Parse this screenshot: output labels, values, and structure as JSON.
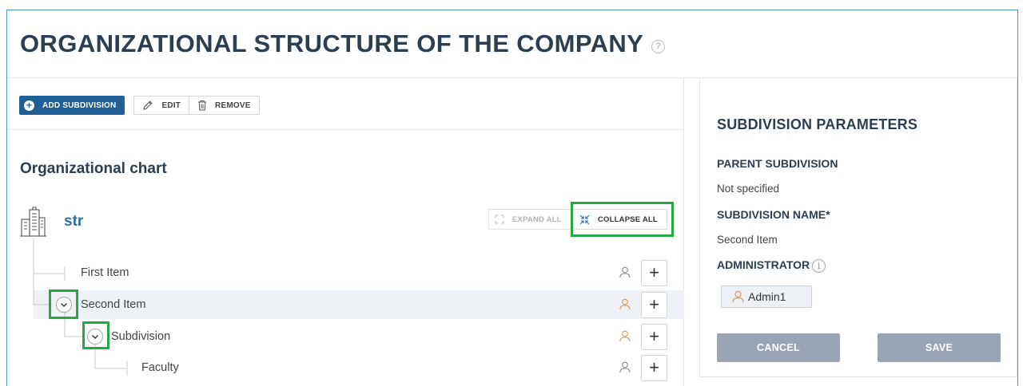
{
  "page": {
    "title": "ORGANIZATIONAL STRUCTURE OF THE COMPANY",
    "help_glyph": "?"
  },
  "toolbar": {
    "add_label": "ADD SUBDIVISION",
    "edit_label": "EDIT",
    "remove_label": "REMOVE"
  },
  "chart": {
    "title": "Organizational chart",
    "root_name": "str",
    "expand_label": "EXPAND ALL",
    "collapse_label": "COLLAPSE ALL",
    "nodes": [
      {
        "label": "First Item",
        "user_color": "#888888"
      },
      {
        "label": "Second Item",
        "user_color": "#e8914a",
        "selected": true,
        "expanded": true
      },
      {
        "label": "Subdivision",
        "user_color": "#e8914a",
        "expanded": true
      },
      {
        "label": "Faculty",
        "user_color": "#888888"
      }
    ],
    "add_child_glyph": "+"
  },
  "params": {
    "title": "SUBDIVISION PARAMETERS",
    "parent_label": "PARENT SUBDIVISION",
    "parent_value": "Not specified",
    "name_label": "SUBDIVISION NAME*",
    "name_value": "Second Item",
    "admin_label": "ADMINISTRATOR",
    "info_glyph": "i",
    "admin_value": "Admin1",
    "cancel_label": "CANCEL",
    "save_label": "SAVE"
  },
  "colors": {
    "primary": "#1f5f96",
    "accent_link": "#2b6ea6",
    "highlight": "#27a745",
    "user_orange": "#e8914a",
    "disabled_button": "#9aa4b2"
  }
}
